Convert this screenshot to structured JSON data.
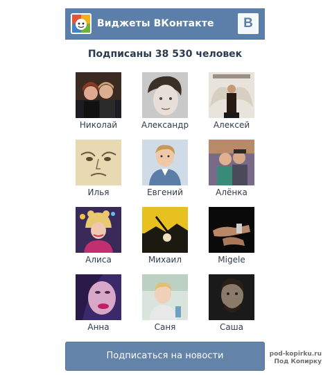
{
  "header": {
    "title": "Виджеты ВКонтакте",
    "vk_logo_text": "В"
  },
  "subscribers_text": "Подписаны 38 530 человек",
  "members": [
    {
      "name": "Николай",
      "avatar": "couple-photo"
    },
    {
      "name": "Александр",
      "avatar": "man-face-photo"
    },
    {
      "name": "Алексей",
      "avatar": "winged-figure-photo"
    },
    {
      "name": "Илья",
      "avatar": "sketch-face-drawing"
    },
    {
      "name": "Евгений",
      "avatar": "young-man-photo"
    },
    {
      "name": "Алёнка",
      "avatar": "group-photo"
    },
    {
      "name": "Алиса",
      "avatar": "girl-hat-photo"
    },
    {
      "name": "Михаил",
      "avatar": "dark-landscape-photo"
    },
    {
      "name": "Migele",
      "avatar": "arms-photo"
    },
    {
      "name": "Анна",
      "avatar": "woman-lips-photo"
    },
    {
      "name": "Саня",
      "avatar": "young-man-outdoor-photo"
    },
    {
      "name": "Саша",
      "avatar": "dark-face-photo"
    }
  ],
  "subscribe_button": "Подписаться на новости",
  "watermark": {
    "line1": "pod-kopirku.ru",
    "line2": "Под Копирку"
  },
  "colors": {
    "header_bg": "#5b7fa8",
    "button_bg": "#6383a8",
    "title_text": "#2a3a4f"
  }
}
